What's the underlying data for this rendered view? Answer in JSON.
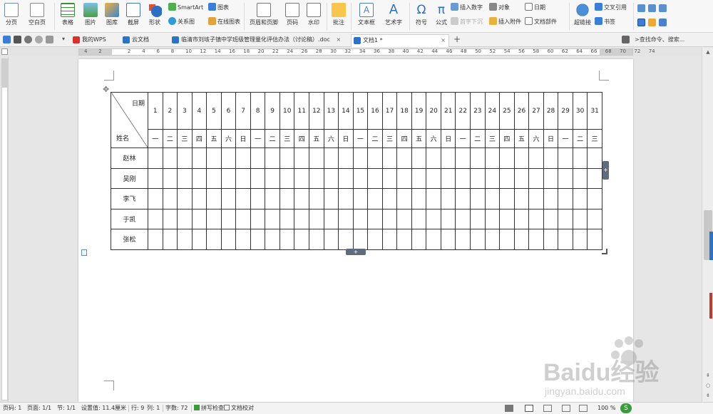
{
  "ribbon": {
    "page_break": "分页",
    "blank_page": "空白页",
    "table": "表格",
    "picture": "图片",
    "gallery": "图库",
    "screenshot": "截屏",
    "shapes": "形状",
    "smartart": "SmartArt",
    "chart": "图表",
    "relation_chart": "关系图",
    "online_chart": "在线图表",
    "header_footer": "页眉和页脚",
    "page_number": "页码",
    "watermark": "水印",
    "comment": "批注",
    "textbox": "文本框",
    "wordart": "艺术字",
    "symbol": "符号",
    "formula": "公式",
    "insert_number": "插入数字",
    "object": "对象",
    "date": "日期",
    "first_char_sink": "首字下沉",
    "insert_attachment": "插入附件",
    "doc_parts": "文档部件",
    "hyperlink": "超链接",
    "cross_ref": "交叉引用",
    "bookmark": "书签",
    "symbol_glyph": "Ω",
    "formula_glyph": "π",
    "textbox_glyph": "A",
    "wordart_glyph": "A"
  },
  "tabs": {
    "my_wps": "我的WPS",
    "cloud_docs": "云文档",
    "doc1": "临清市刘垓子镇中学班级管理量化评估办法（讨论稿）.doc",
    "doc2": "文档1 *",
    "close": "×",
    "new_tab": "+",
    "search": ">查找命令、搜索..."
  },
  "ruler": {
    "numbers": [
      "4",
      "2",
      "",
      "2",
      "4",
      "6",
      "8",
      "10",
      "12",
      "14",
      "16",
      "18",
      "20",
      "22",
      "24",
      "26",
      "28",
      "30",
      "32",
      "34",
      "36",
      "38",
      "40",
      "42",
      "44",
      "46",
      "48",
      "50",
      "52",
      "54",
      "56",
      "58",
      "60",
      "62",
      "64",
      "66",
      "68",
      "70",
      "72",
      "74"
    ]
  },
  "table": {
    "corner_top": "日期",
    "corner_bottom": "姓名",
    "days": [
      "1",
      "2",
      "3",
      "4",
      "5",
      "6",
      "7",
      "8",
      "9",
      "10",
      "11",
      "12",
      "13",
      "14",
      "15",
      "16",
      "17",
      "18",
      "19",
      "20",
      "21",
      "22",
      "23",
      "24",
      "25",
      "26",
      "27",
      "28",
      "29",
      "30",
      "31"
    ],
    "weekdays": [
      "一",
      "二",
      "三",
      "四",
      "五",
      "六",
      "日",
      "一",
      "二",
      "三",
      "四",
      "五",
      "六",
      "日",
      "一",
      "二",
      "三",
      "四",
      "五",
      "六",
      "日",
      "一",
      "二",
      "三",
      "四",
      "五",
      "六",
      "日",
      "一",
      "二",
      "三"
    ],
    "names": [
      "赵林",
      "吴刚",
      "李飞",
      "于凯",
      "张松"
    ]
  },
  "status": {
    "page_no": "页码: 1",
    "pages": "页面: 1/1",
    "section": "节: 1/1",
    "setting": "设置值: 11.4厘米",
    "row": "行: 9",
    "col": "列: 1",
    "word_count": "字数: 72",
    "spell_check": "拼写检查",
    "proofread": "文档校对",
    "zoom": "100 %"
  },
  "watermark": {
    "logo": "Baidu经验",
    "url": "jingyan.baidu.com"
  },
  "colors": {
    "accent": "#2b73c7",
    "wps_red": "#d9302c",
    "green": "#3a9b3a",
    "table_border": "#333333"
  }
}
